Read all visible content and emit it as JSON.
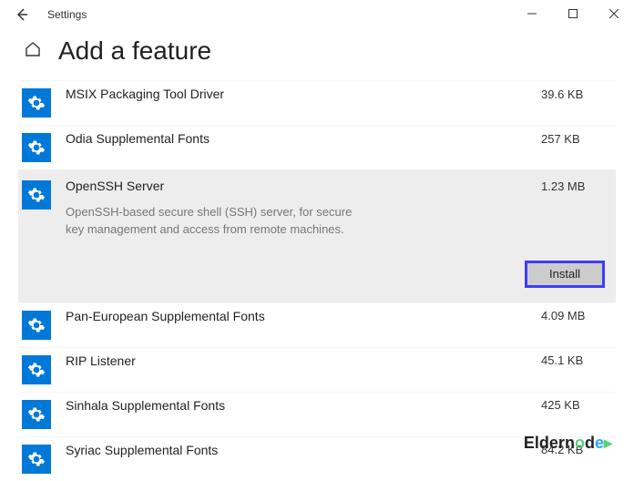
{
  "window": {
    "app_title": "Settings"
  },
  "header": {
    "title": "Add a feature"
  },
  "features": [
    {
      "name": "MSIX Packaging Tool Driver",
      "size": "39.6 KB"
    },
    {
      "name": "Odia Supplemental Fonts",
      "size": "257 KB"
    },
    {
      "name": "OpenSSH Server",
      "size": "1.23 MB",
      "description": "OpenSSH-based secure shell (SSH) server, for secure key management and access from remote machines.",
      "selected": true,
      "install_label": "Install"
    },
    {
      "name": "Pan-European Supplemental Fonts",
      "size": "4.09 MB"
    },
    {
      "name": "RIP Listener",
      "size": "45.1 KB"
    },
    {
      "name": "Sinhala Supplemental Fonts",
      "size": "425 KB"
    },
    {
      "name": "Syriac Supplemental Fonts",
      "size": "84.2 KB"
    }
  ],
  "watermark": {
    "text": "Eldernode"
  }
}
